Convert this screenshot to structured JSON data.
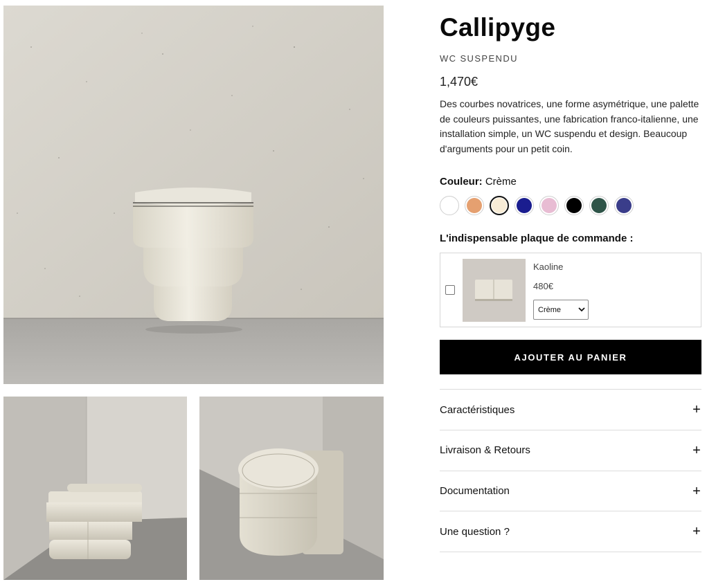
{
  "product": {
    "title": "Callipyge",
    "subtitle": "WC SUSPENDU",
    "price": "1,470€",
    "description": "Des courbes novatrices, une forme asymétrique, une palette de couleurs puissantes, une fabrication franco-italienne, une installation simple, un WC suspendu et design. Beaucoup d'arguments pour un petit coin."
  },
  "color": {
    "label": "Couleur:",
    "selected": "Crème",
    "swatches": [
      {
        "name": "blanc",
        "hex": "#ffffff"
      },
      {
        "name": "terracotta",
        "hex": "#e5a070"
      },
      {
        "name": "creme",
        "hex": "#f8ecd6",
        "active": true
      },
      {
        "name": "bleu",
        "hex": "#1a1d8f"
      },
      {
        "name": "rose",
        "hex": "#e8bcd3"
      },
      {
        "name": "noir",
        "hex": "#000000"
      },
      {
        "name": "vert-terrazzo",
        "hex": "#2e5448"
      },
      {
        "name": "bleu-terrazzo",
        "hex": "#3a3d8a"
      }
    ]
  },
  "addon": {
    "heading": "L'indispensable plaque de commande :",
    "name": "Kaoline",
    "price": "480€",
    "select_value": "Crème"
  },
  "cart_button": "AJOUTER AU PANIER",
  "accordion": [
    {
      "label": "Caractéristiques"
    },
    {
      "label": "Livraison & Retours"
    },
    {
      "label": "Documentation"
    },
    {
      "label": "Une question ?"
    }
  ],
  "icons": {
    "plus": "+",
    "chevron": "⌄"
  },
  "colors": {
    "button_bg": "#000000",
    "border": "#dcdcdc",
    "product_creme": "#ece8de"
  }
}
